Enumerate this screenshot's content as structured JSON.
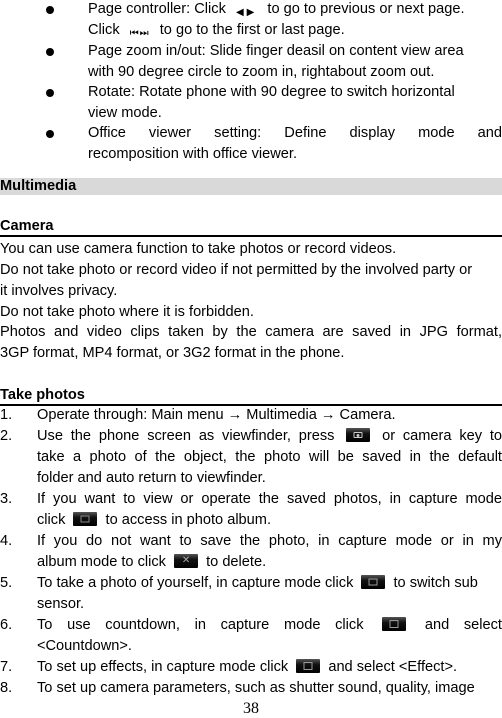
{
  "bullets": [
    {
      "lines": [
        {
          "pre": "Page controller: Click ",
          "icon": "prev-next-arrows-icon",
          "post": " to go to previous or next page."
        },
        {
          "pre": "Click ",
          "icon": "first-last-page-icon",
          "post": " to go to the first or last page."
        }
      ]
    },
    {
      "lines": [
        {
          "text": "Page zoom in/out: Slide finger deasil on content view area"
        },
        {
          "text": "with 90 degree circle to zoom in, rightabout zoom out."
        }
      ]
    },
    {
      "lines": [
        {
          "text": "Rotate: Rotate phone with 90 degree to switch horizontal"
        },
        {
          "text": "view mode."
        }
      ]
    },
    {
      "lines": [
        {
          "text": "Office viewer setting: Define display mode and"
        },
        {
          "text": "recomposition with office viewer."
        }
      ]
    }
  ],
  "section_title": "Multimedia",
  "camera": {
    "heading": "Camera",
    "paragraphs": [
      "You can use camera function to take photos or record videos.",
      "Do not take photo or record video if not permitted by the involved party or",
      "it involves privacy.",
      "Do not take photo where it is forbidden.",
      "Photos and video clips taken by the camera are saved in JPG format,",
      "3GP format, MP4 format, or 3G2 format in the phone."
    ]
  },
  "take_photos": {
    "heading": "Take photos",
    "steps": [
      {
        "num": "1.",
        "lines": [
          {
            "text": "Operate through: Main menu → Multimedia → Camera."
          }
        ]
      },
      {
        "num": "2.",
        "lines": [
          {
            "pre": "Use the phone screen as viewfinder, press",
            "icon": "camera-shutter-icon",
            "post": "or camera key to"
          },
          {
            "text": "take a photo of the object, the photo will be saved in the default"
          },
          {
            "text": "folder and auto return to viewfinder."
          }
        ]
      },
      {
        "num": "3.",
        "lines": [
          {
            "text": "If you want to view or operate the saved photos, in capture mode"
          },
          {
            "pre": "click",
            "icon": "photo-album-icon",
            "post": "to access in photo album."
          }
        ]
      },
      {
        "num": "4.",
        "lines": [
          {
            "text": "If you do not want to save the photo, in capture mode or in my"
          },
          {
            "pre": "album mode to click",
            "icon": "delete-icon",
            "post": "to delete."
          }
        ]
      },
      {
        "num": "5.",
        "lines": [
          {
            "pre": "To take a photo of yourself, in capture mode click",
            "icon": "switch-sensor-icon",
            "post": "to switch sub"
          },
          {
            "text": "sensor."
          }
        ]
      },
      {
        "num": "6.",
        "lines": [
          {
            "pre": "To use countdown, in capture mode click",
            "icon": "settings-menu-icon",
            "post": "and select"
          },
          {
            "text": "<Countdown>."
          }
        ]
      },
      {
        "num": "7.",
        "lines": [
          {
            "pre": "To set up effects, in capture mode click",
            "icon": "settings-menu-icon",
            "post": "and select <Effect>."
          }
        ]
      },
      {
        "num": "8.",
        "lines": [
          {
            "text": "To set up camera parameters, such as shutter sound, quality, image"
          }
        ]
      }
    ]
  },
  "page_number": "38"
}
